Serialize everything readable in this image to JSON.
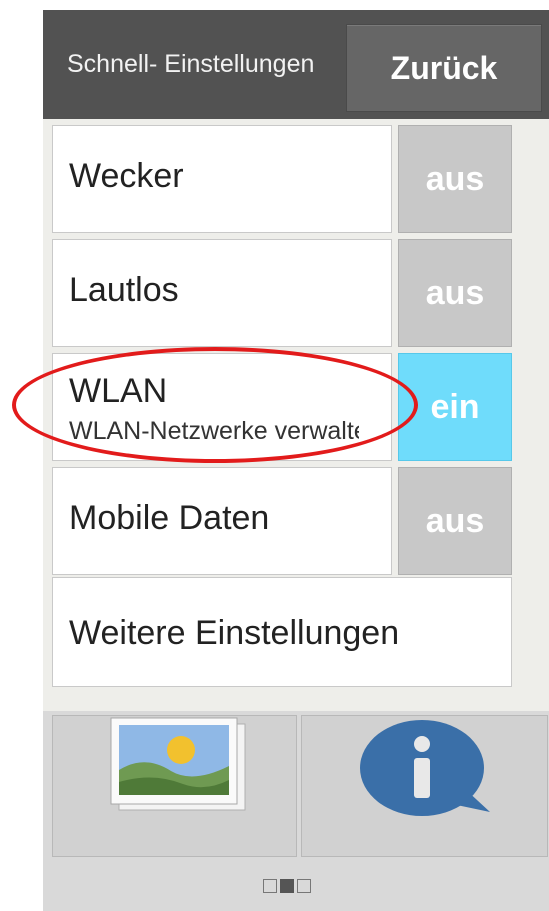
{
  "header": {
    "title": "Schnell- Einstellungen",
    "back_label": "Zurück"
  },
  "rows": [
    {
      "title": "Wecker",
      "state": "aus"
    },
    {
      "title": "Lautlos",
      "state": "aus"
    },
    {
      "title": "WLAN",
      "subtitle": "WLAN-Netzwerke verwalten",
      "state": "ein"
    },
    {
      "title": "Mobile Daten",
      "state": "aus"
    }
  ],
  "more": {
    "label": "Weitere Einstellungen"
  },
  "colors": {
    "header": "#525252",
    "toggle_on": "#6fdcfb",
    "toggle_off": "#c8c8c8",
    "highlight": "#e21b1b"
  },
  "icons": [
    "gallery-icon",
    "info-icon"
  ],
  "pager": {
    "pages": 3,
    "current": 2
  }
}
